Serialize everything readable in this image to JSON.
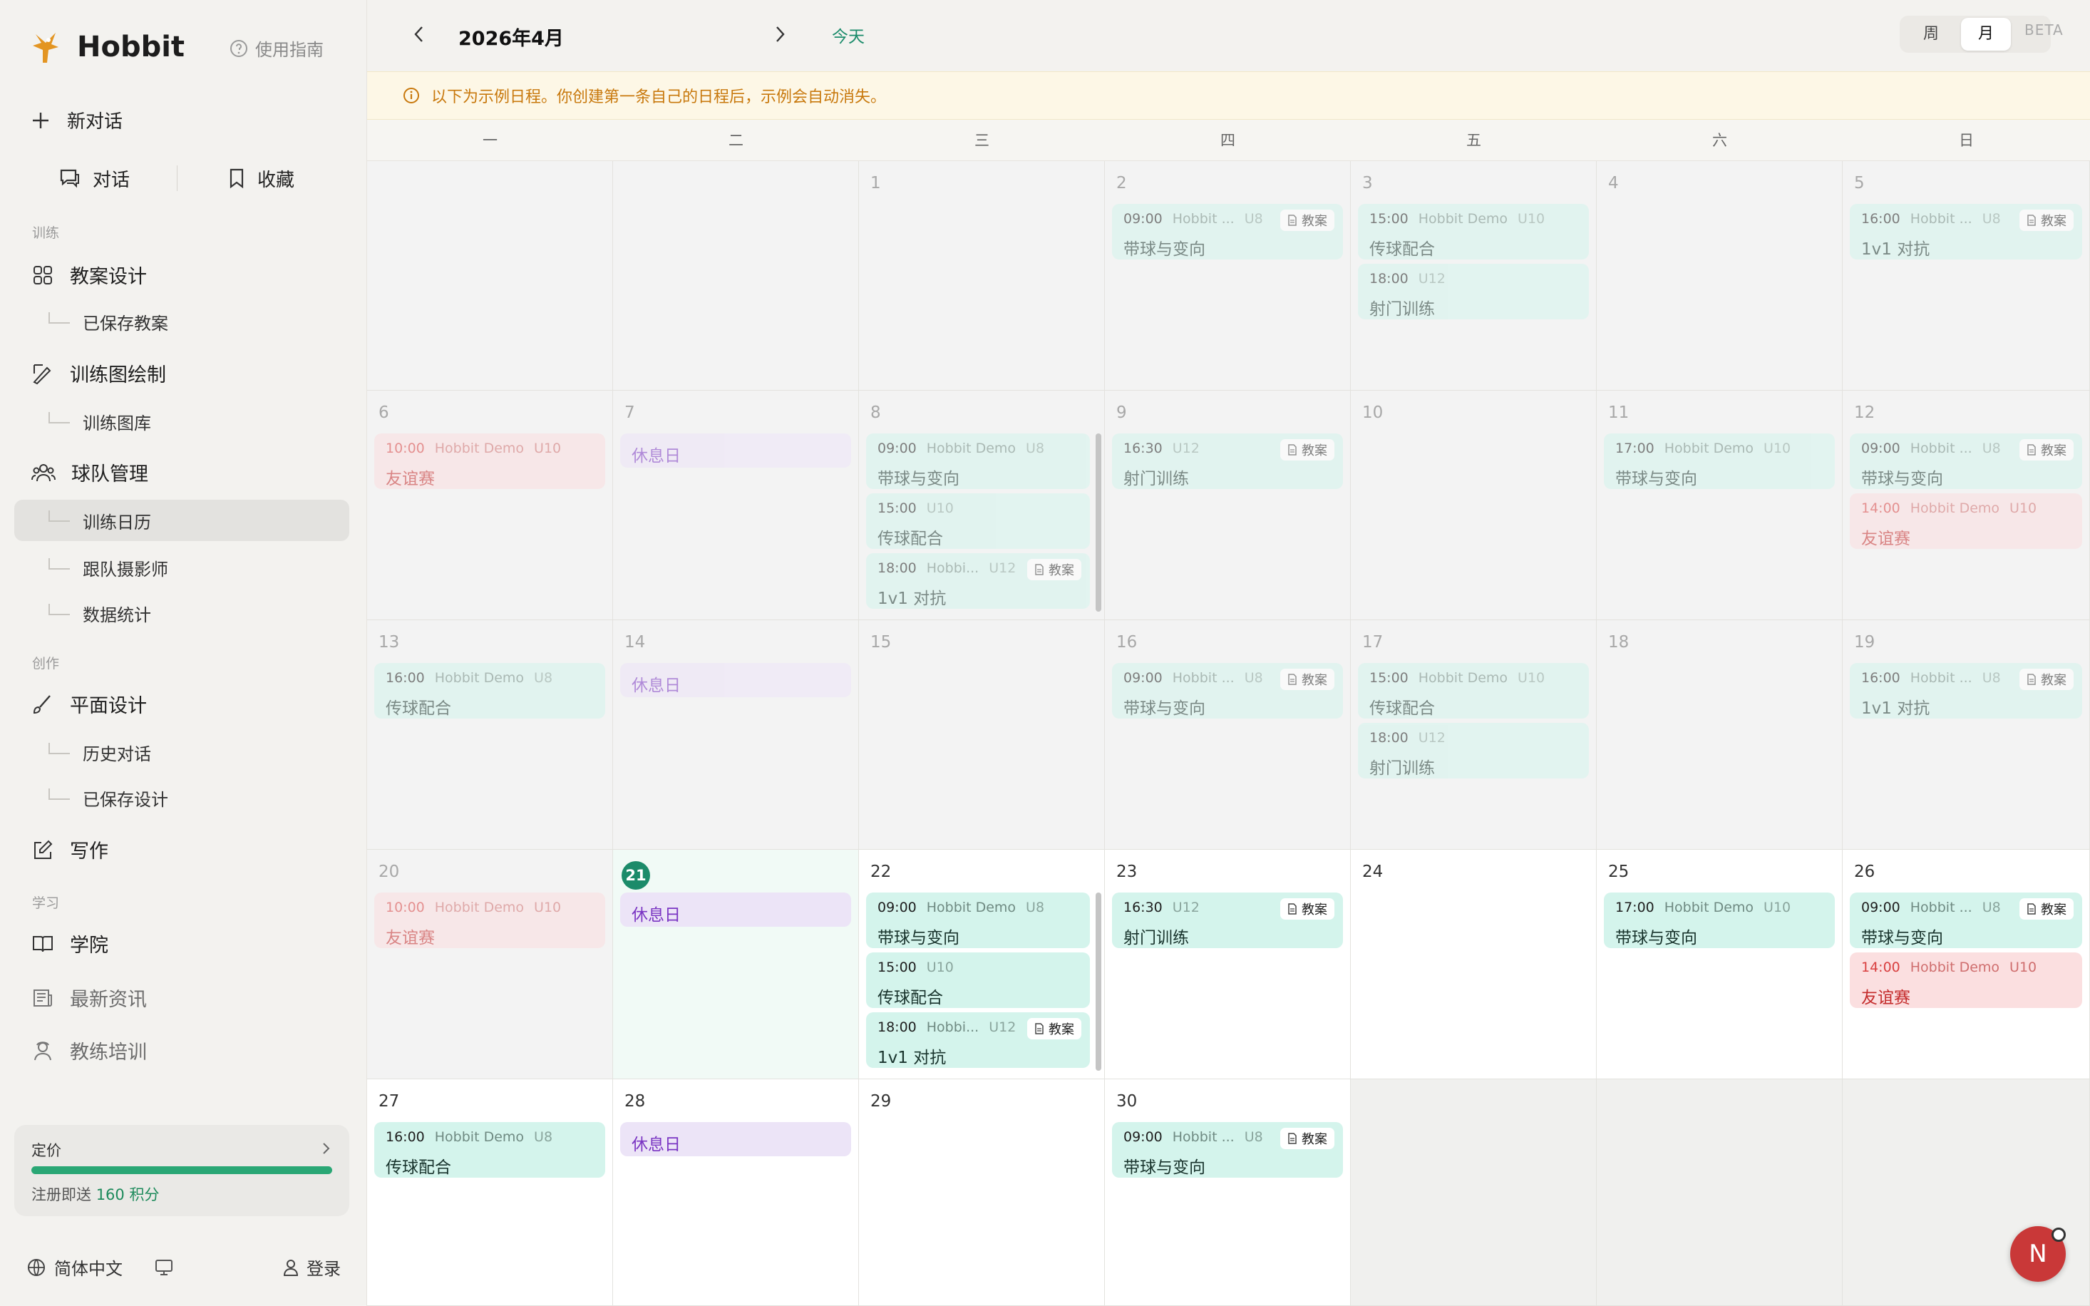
{
  "app": {
    "name": "Hobbit",
    "guide": "使用指南",
    "new_chat": "新对话",
    "chat_tab": "对话",
    "favorites_tab": "收藏"
  },
  "sidebar": {
    "sec_train": "训练",
    "lesson_design": "教案设计",
    "saved_lessons": "已保存教案",
    "diagram_draw": "训练图绘制",
    "diagram_library": "训练图库",
    "team_mgmt": "球队管理",
    "calendar": "训练日历",
    "photographer": "跟队摄影师",
    "stats": "数据统计",
    "sec_create": "创作",
    "graphic_design": "平面设计",
    "history_chat": "历史对话",
    "saved_design": "已保存设计",
    "writing": "写作",
    "sec_learn": "学习",
    "academy": "学院",
    "news": "最新资讯",
    "coach_training": "教练培训"
  },
  "pricing": {
    "title": "定价",
    "note_prefix": "注册即送 ",
    "note_credits": "160 积分",
    "progress": 1.0
  },
  "footer": {
    "language": "简体中文",
    "login": "登录"
  },
  "header": {
    "month": "2026年4月",
    "today": "今天",
    "week": "周",
    "month_view": "月",
    "beta": "BETA"
  },
  "banner": "以下为示例日程。你创建第一条自己的日程后，示例会自动消失。",
  "weekdays": [
    "一",
    "二",
    "三",
    "四",
    "五",
    "六",
    "日"
  ],
  "today_day": 21,
  "weeks": [
    [
      {
        "day": "",
        "state": "past",
        "events": []
      },
      {
        "day": "",
        "state": "past",
        "events": []
      },
      {
        "day": "1",
        "state": "past",
        "events": []
      },
      {
        "day": "2",
        "state": "past",
        "events": [
          {
            "time": "09:00",
            "team": "Hobbit ...",
            "age": "U8",
            "title": "带球与变向",
            "badge": "教案",
            "kind": "green"
          }
        ]
      },
      {
        "day": "3",
        "state": "past",
        "events": [
          {
            "time": "15:00",
            "team": "Hobbit Demo",
            "age": "U10",
            "title": "传球配合",
            "kind": "green"
          },
          {
            "time": "18:00",
            "team": "",
            "age": "U12",
            "title": "射门训练",
            "kind": "green"
          }
        ]
      },
      {
        "day": "4",
        "state": "past",
        "events": []
      },
      {
        "day": "5",
        "state": "past",
        "events": [
          {
            "time": "16:00",
            "team": "Hobbit ...",
            "age": "U8",
            "title": "1v1 对抗",
            "badge": "教案",
            "kind": "green"
          }
        ]
      }
    ],
    [
      {
        "day": "6",
        "state": "past",
        "events": [
          {
            "time": "10:00",
            "team": "Hobbit Demo",
            "age": "U10",
            "title": "友谊赛",
            "kind": "red"
          }
        ]
      },
      {
        "day": "7",
        "state": "past",
        "events": [
          {
            "title": "休息日",
            "kind": "rest"
          }
        ]
      },
      {
        "day": "8",
        "state": "past",
        "scroll": true,
        "events": [
          {
            "time": "09:00",
            "team": "Hobbit Demo",
            "age": "U8",
            "title": "带球与变向",
            "kind": "green"
          },
          {
            "time": "15:00",
            "team": "",
            "age": "U10",
            "title": "传球配合",
            "kind": "green"
          },
          {
            "time": "18:00",
            "team": "Hobbi...",
            "age": "U12",
            "title": "1v1 对抗",
            "badge": "教案",
            "kind": "green"
          }
        ]
      },
      {
        "day": "9",
        "state": "past",
        "events": [
          {
            "time": "16:30",
            "team": "",
            "age": "U12",
            "title": "射门训练",
            "badge": "教案",
            "kind": "green"
          }
        ]
      },
      {
        "day": "10",
        "state": "past",
        "events": []
      },
      {
        "day": "11",
        "state": "past",
        "events": [
          {
            "time": "17:00",
            "team": "Hobbit Demo",
            "age": "U10",
            "title": "带球与变向",
            "kind": "green"
          }
        ]
      },
      {
        "day": "12",
        "state": "past",
        "events": [
          {
            "time": "09:00",
            "team": "Hobbit ...",
            "age": "U8",
            "title": "带球与变向",
            "badge": "教案",
            "kind": "green"
          },
          {
            "time": "14:00",
            "team": "Hobbit Demo",
            "age": "U10",
            "title": "友谊赛",
            "kind": "red"
          }
        ]
      }
    ],
    [
      {
        "day": "13",
        "state": "past",
        "events": [
          {
            "time": "16:00",
            "team": "Hobbit Demo",
            "age": "U8",
            "title": "传球配合",
            "kind": "green"
          }
        ]
      },
      {
        "day": "14",
        "state": "past",
        "events": [
          {
            "title": "休息日",
            "kind": "rest"
          }
        ]
      },
      {
        "day": "15",
        "state": "past",
        "events": []
      },
      {
        "day": "16",
        "state": "past",
        "events": [
          {
            "time": "09:00",
            "team": "Hobbit ...",
            "age": "U8",
            "title": "带球与变向",
            "badge": "教案",
            "kind": "green"
          }
        ]
      },
      {
        "day": "17",
        "state": "past",
        "events": [
          {
            "time": "15:00",
            "team": "Hobbit Demo",
            "age": "U10",
            "title": "传球配合",
            "kind": "green"
          },
          {
            "time": "18:00",
            "team": "",
            "age": "U12",
            "title": "射门训练",
            "kind": "green"
          }
        ]
      },
      {
        "day": "18",
        "state": "past",
        "events": []
      },
      {
        "day": "19",
        "state": "past",
        "events": [
          {
            "time": "16:00",
            "team": "Hobbit ...",
            "age": "U8",
            "title": "1v1 对抗",
            "badge": "教案",
            "kind": "green"
          }
        ]
      }
    ],
    [
      {
        "day": "20",
        "state": "past",
        "events": [
          {
            "time": "10:00",
            "team": "Hobbit Demo",
            "age": "U10",
            "title": "友谊赛",
            "kind": "red"
          }
        ]
      },
      {
        "day": "21",
        "state": "today",
        "events": [
          {
            "title": "休息日",
            "kind": "rest"
          }
        ]
      },
      {
        "day": "22",
        "state": "future",
        "scroll": true,
        "events": [
          {
            "time": "09:00",
            "team": "Hobbit Demo",
            "age": "U8",
            "title": "带球与变向",
            "kind": "green"
          },
          {
            "time": "15:00",
            "team": "",
            "age": "U10",
            "title": "传球配合",
            "kind": "green"
          },
          {
            "time": "18:00",
            "team": "Hobbi...",
            "age": "U12",
            "title": "1v1 对抗",
            "badge": "教案",
            "kind": "green"
          }
        ]
      },
      {
        "day": "23",
        "state": "future",
        "events": [
          {
            "time": "16:30",
            "team": "",
            "age": "U12",
            "title": "射门训练",
            "badge": "教案",
            "kind": "green"
          }
        ]
      },
      {
        "day": "24",
        "state": "future",
        "events": []
      },
      {
        "day": "25",
        "state": "future",
        "events": [
          {
            "time": "17:00",
            "team": "Hobbit Demo",
            "age": "U10",
            "title": "带球与变向",
            "kind": "green"
          }
        ]
      },
      {
        "day": "26",
        "state": "future",
        "events": [
          {
            "time": "09:00",
            "team": "Hobbit ...",
            "age": "U8",
            "title": "带球与变向",
            "badge": "教案",
            "kind": "green"
          },
          {
            "time": "14:00",
            "team": "Hobbit Demo",
            "age": "U10",
            "title": "友谊赛",
            "kind": "red"
          }
        ]
      }
    ],
    [
      {
        "day": "27",
        "state": "future",
        "events": [
          {
            "time": "16:00",
            "team": "Hobbit Demo",
            "age": "U8",
            "title": "传球配合",
            "kind": "green"
          }
        ]
      },
      {
        "day": "28",
        "state": "future",
        "events": [
          {
            "title": "休息日",
            "kind": "rest"
          }
        ]
      },
      {
        "day": "29",
        "state": "future",
        "events": []
      },
      {
        "day": "30",
        "state": "future",
        "events": [
          {
            "time": "09:00",
            "team": "Hobbit ...",
            "age": "U8",
            "title": "带球与变向",
            "badge": "教案",
            "kind": "green"
          }
        ]
      },
      {
        "day": "",
        "state": "blank",
        "events": []
      },
      {
        "day": "",
        "state": "blank",
        "events": []
      },
      {
        "day": "",
        "state": "blank",
        "events": []
      }
    ]
  ],
  "avatar_initial": "N"
}
